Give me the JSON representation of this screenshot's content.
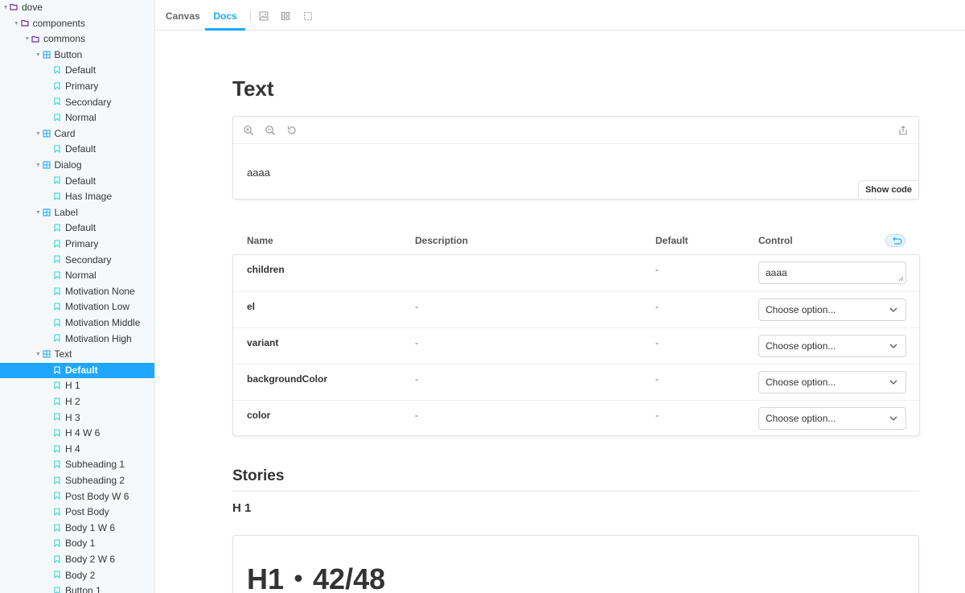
{
  "sidebar": {
    "rows": [
      {
        "label": "dove",
        "depth": 0,
        "kind": "folder",
        "expanded": true
      },
      {
        "label": "components",
        "depth": 1,
        "kind": "folder",
        "expanded": true
      },
      {
        "label": "commons",
        "depth": 2,
        "kind": "folder",
        "expanded": true
      },
      {
        "label": "Button",
        "depth": 3,
        "kind": "component",
        "expanded": true
      },
      {
        "label": "Default",
        "depth": 4,
        "kind": "story"
      },
      {
        "label": "Primary",
        "depth": 4,
        "kind": "story"
      },
      {
        "label": "Secondary",
        "depth": 4,
        "kind": "story"
      },
      {
        "label": "Normal",
        "depth": 4,
        "kind": "story"
      },
      {
        "label": "Card",
        "depth": 3,
        "kind": "component",
        "expanded": true
      },
      {
        "label": "Default",
        "depth": 4,
        "kind": "story"
      },
      {
        "label": "Dialog",
        "depth": 3,
        "kind": "component",
        "expanded": true
      },
      {
        "label": "Default",
        "depth": 4,
        "kind": "story"
      },
      {
        "label": "Has Image",
        "depth": 4,
        "kind": "story"
      },
      {
        "label": "Label",
        "depth": 3,
        "kind": "component",
        "expanded": true
      },
      {
        "label": "Default",
        "depth": 4,
        "kind": "story"
      },
      {
        "label": "Primary",
        "depth": 4,
        "kind": "story"
      },
      {
        "label": "Secondary",
        "depth": 4,
        "kind": "story"
      },
      {
        "label": "Normal",
        "depth": 4,
        "kind": "story"
      },
      {
        "label": "Motivation None",
        "depth": 4,
        "kind": "story"
      },
      {
        "label": "Motivation Low",
        "depth": 4,
        "kind": "story"
      },
      {
        "label": "Motivation Middle",
        "depth": 4,
        "kind": "story"
      },
      {
        "label": "Motivation High",
        "depth": 4,
        "kind": "story"
      },
      {
        "label": "Text",
        "depth": 3,
        "kind": "component",
        "expanded": true
      },
      {
        "label": "Default",
        "depth": 4,
        "kind": "story",
        "selected": true
      },
      {
        "label": "H 1",
        "depth": 4,
        "kind": "story"
      },
      {
        "label": "H 2",
        "depth": 4,
        "kind": "story"
      },
      {
        "label": "H 3",
        "depth": 4,
        "kind": "story"
      },
      {
        "label": "H 4 W 6",
        "depth": 4,
        "kind": "story"
      },
      {
        "label": "H 4",
        "depth": 4,
        "kind": "story"
      },
      {
        "label": "Subheading 1",
        "depth": 4,
        "kind": "story"
      },
      {
        "label": "Subheading 2",
        "depth": 4,
        "kind": "story"
      },
      {
        "label": "Post Body W 6",
        "depth": 4,
        "kind": "story"
      },
      {
        "label": "Post Body",
        "depth": 4,
        "kind": "story"
      },
      {
        "label": "Body 1 W 6",
        "depth": 4,
        "kind": "story"
      },
      {
        "label": "Body 1",
        "depth": 4,
        "kind": "story"
      },
      {
        "label": "Body 2 W 6",
        "depth": 4,
        "kind": "story"
      },
      {
        "label": "Body 2",
        "depth": 4,
        "kind": "story"
      },
      {
        "label": "Button 1",
        "depth": 4,
        "kind": "story"
      }
    ]
  },
  "toolbar": {
    "tabs": [
      {
        "label": "Canvas",
        "active": false
      },
      {
        "label": "Docs",
        "active": true
      }
    ],
    "icons": [
      "image-background-icon",
      "grid-icon",
      "outline-icon"
    ]
  },
  "doc": {
    "title": "Text",
    "preview": {
      "content": "aaaa",
      "show_code_label": "Show code",
      "icons": [
        "zoom-in-icon",
        "zoom-out-icon",
        "zoom-reset-icon",
        "share-icon"
      ]
    },
    "args_table": {
      "headers": {
        "name": "Name",
        "description": "Description",
        "default": "Default",
        "control": "Control"
      },
      "rows": [
        {
          "name": "children",
          "description": "",
          "default": "-",
          "control_type": "text",
          "control_value": "aaaa"
        },
        {
          "name": "el",
          "description": "-",
          "default": "-",
          "control_type": "select",
          "control_value": "Choose option..."
        },
        {
          "name": "variant",
          "description": "-",
          "default": "-",
          "control_type": "select",
          "control_value": "Choose option..."
        },
        {
          "name": "backgroundColor",
          "description": "-",
          "default": "-",
          "control_type": "select",
          "control_value": "Choose option..."
        },
        {
          "name": "color",
          "description": "-",
          "default": "-",
          "control_type": "select",
          "control_value": "Choose option..."
        }
      ]
    },
    "stories": {
      "title": "Stories",
      "items": [
        {
          "title": "H 1",
          "sample": "H1・42/48"
        }
      ]
    }
  },
  "colors": {
    "accent": "#1ea7fd",
    "folder": "#6f2cac",
    "component": "#1ea7fd",
    "story": "#37d5d3"
  }
}
